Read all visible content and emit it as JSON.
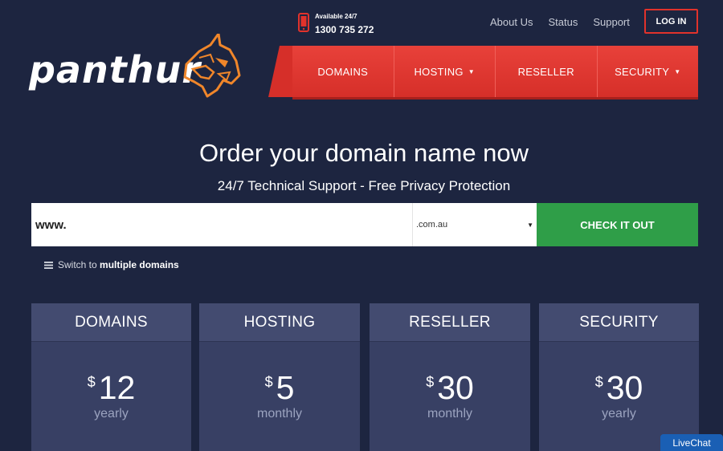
{
  "brand": {
    "name": "panthur"
  },
  "phone": {
    "label": "Available 24/7",
    "number": "1300 735 272"
  },
  "toplinks": [
    "About Us",
    "Status",
    "Support"
  ],
  "login_label": "LOG IN",
  "nav": [
    {
      "label": "DOMAINS",
      "caret": ""
    },
    {
      "label": "HOSTING",
      "caret": "▼"
    },
    {
      "label": "RESELLER",
      "caret": ""
    },
    {
      "label": "SECURITY",
      "caret": "▼"
    }
  ],
  "hero": {
    "title": "Order your domain name now",
    "subtitle": "24/7 Technical Support - Free Privacy Protection"
  },
  "search": {
    "value": "www.",
    "tld": ".com.au",
    "button": "CHECK IT OUT"
  },
  "switch": {
    "prefix": "Switch to",
    "bold": "multiple domains"
  },
  "cards": [
    {
      "title": "DOMAINS",
      "currency": "$",
      "price": "12",
      "period": "yearly"
    },
    {
      "title": "HOSTING",
      "currency": "$",
      "price": "5",
      "period": "monthly"
    },
    {
      "title": "RESELLER",
      "currency": "$",
      "price": "30",
      "period": "monthly"
    },
    {
      "title": "SECURITY",
      "currency": "$",
      "price": "30",
      "period": "yearly"
    }
  ],
  "livechat": "LiveChat",
  "colors": {
    "background": "#1d2540",
    "accent_red": "#e1322b",
    "green": "#2f9e48",
    "logo_orange": "#f0862a"
  }
}
